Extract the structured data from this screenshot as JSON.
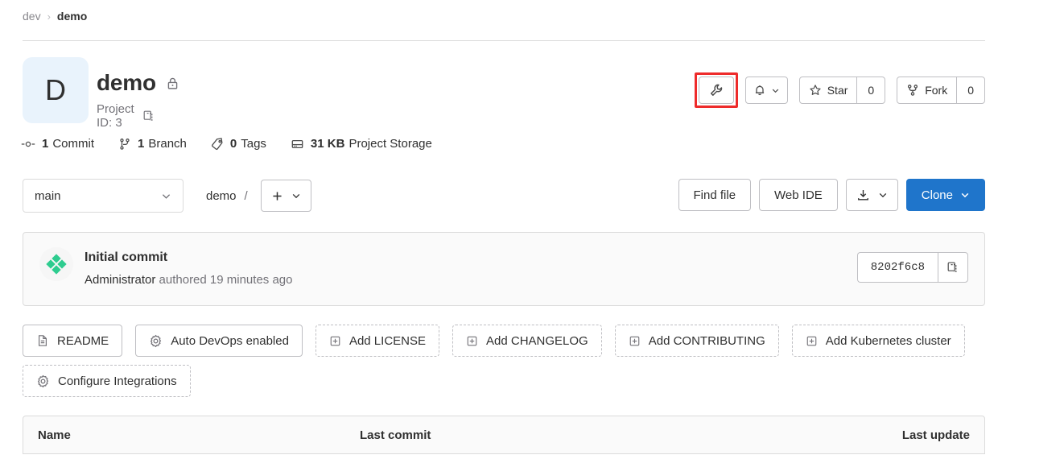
{
  "breadcrumb": {
    "group": "dev",
    "separator": "›",
    "project": "demo"
  },
  "project": {
    "avatar_letter": "D",
    "name": "demo",
    "visibility_icon": "lock-icon",
    "id_label": "Project ID: 3",
    "copy_icon": "copy-icon",
    "avatar_bg": "#e9f3fc"
  },
  "actions": {
    "settings": {
      "icon": "wrench-icon",
      "highlight_color": "#ee2b2b"
    },
    "notifications": {
      "icon": "bell-icon",
      "chevron": "⌄"
    },
    "star": {
      "label": "Star",
      "count": "0",
      "icon": "star-icon"
    },
    "fork": {
      "label": "Fork",
      "count": "0",
      "icon": "fork-icon"
    }
  },
  "stats": [
    {
      "icon": "commit-icon",
      "value": "1",
      "label": "Commit"
    },
    {
      "icon": "branch-icon",
      "value": "1",
      "label": "Branch"
    },
    {
      "icon": "tag-icon",
      "value": "0",
      "label": "Tags"
    },
    {
      "icon": "storage-icon",
      "value": "31 KB",
      "label": "Project Storage"
    }
  ],
  "toolbar": {
    "branch": "main",
    "path": "demo",
    "path_separator": "/",
    "add_button": {
      "icon": "plus-icon",
      "chevron": "⌄"
    },
    "find_file": "Find file",
    "web_ide": "Web IDE",
    "download": {
      "icon": "download-icon",
      "chevron": "⌄"
    },
    "clone": {
      "label": "Clone",
      "chevron": "⌄",
      "color": "#1f75cb"
    }
  },
  "commit": {
    "message": "Initial commit",
    "author": "Administrator",
    "meta": " authored 19 minutes ago",
    "sha": "8202f6c8",
    "copy_icon": "copy-icon",
    "avatar_icon": "identicon",
    "avatar_color": "#2ecc8f"
  },
  "quick_actions": [
    {
      "label": "README",
      "icon": "file-icon",
      "dashed": false
    },
    {
      "label": "Auto DevOps enabled",
      "icon": "gear-icon",
      "dashed": false
    },
    {
      "label": "Add LICENSE",
      "icon": "plus-square-icon",
      "dashed": true
    },
    {
      "label": "Add CHANGELOG",
      "icon": "plus-square-icon",
      "dashed": true
    },
    {
      "label": "Add CONTRIBUTING",
      "icon": "plus-square-icon",
      "dashed": true
    },
    {
      "label": "Add Kubernetes cluster",
      "icon": "plus-square-icon",
      "dashed": true
    },
    {
      "label": "Configure Integrations",
      "icon": "gear-icon",
      "dashed": true
    }
  ],
  "files_table": {
    "col_name": "Name",
    "col_last_commit": "Last commit",
    "col_last_update": "Last update"
  }
}
